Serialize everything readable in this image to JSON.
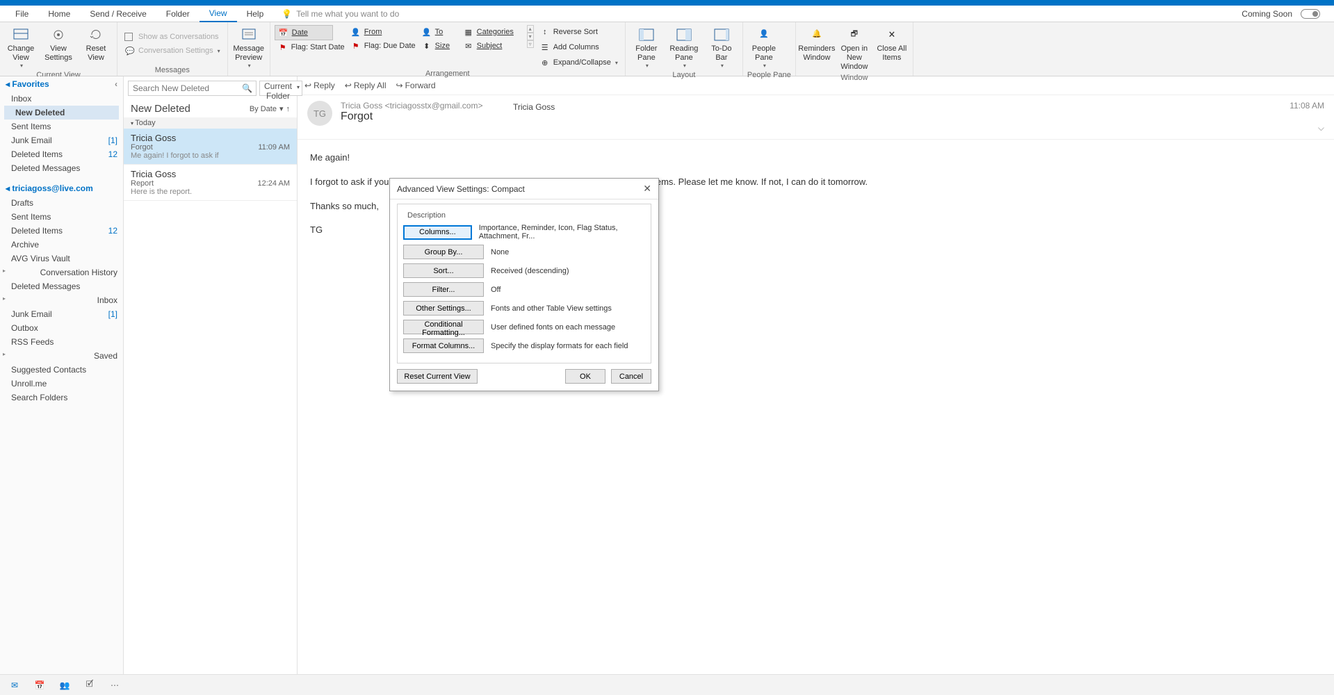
{
  "menu": {
    "tabs": [
      "File",
      "Home",
      "Send / Receive",
      "Folder",
      "View",
      "Help"
    ],
    "active": 4,
    "tellme": "Tell me what you want to do",
    "coming_soon": "Coming Soon",
    "toggle_label": "Off"
  },
  "ribbon": {
    "g1": {
      "change_view": "Change View",
      "view_settings": "View Settings",
      "reset_view": "Reset View",
      "label": "Current View"
    },
    "g2": {
      "show_conv": "Show as Conversations",
      "conv_settings": "Conversation Settings",
      "label": "Messages"
    },
    "g3": {
      "msg_preview": "Message Preview"
    },
    "g4": {
      "date": "Date",
      "from": "From",
      "to": "To",
      "flag_start": "Flag: Start Date",
      "flag_due": "Flag: Due Date",
      "size": "Size",
      "categories": "Categories",
      "subject": "Subject",
      "label": "Arrangement",
      "reverse": "Reverse Sort",
      "add_cols": "Add Columns",
      "expand": "Expand/Collapse"
    },
    "g5": {
      "folder": "Folder Pane",
      "reading": "Reading Pane",
      "todo": "To-Do Bar",
      "label": "Layout"
    },
    "g6": {
      "people": "People Pane",
      "label": "People Pane"
    },
    "g7": {
      "reminders": "Reminders Window",
      "open_new": "Open in New Window",
      "close_all": "Close All Items",
      "label": "Window"
    }
  },
  "nav": {
    "favorites": "Favorites",
    "fav_items": [
      {
        "t": "Inbox"
      },
      {
        "t": "New Deleted",
        "sel": true
      },
      {
        "t": "Sent Items"
      },
      {
        "t": "Junk Email",
        "c": "[1]"
      },
      {
        "t": "Deleted Items",
        "c": "12"
      },
      {
        "t": "Deleted Messages"
      }
    ],
    "account": "triciagoss@live.com",
    "acct_items": [
      {
        "t": "Drafts"
      },
      {
        "t": "Sent Items"
      },
      {
        "t": "Deleted Items",
        "c": "12"
      },
      {
        "t": "Archive"
      },
      {
        "t": "AVG Virus Vault"
      },
      {
        "t": "Conversation History",
        "exp": true
      },
      {
        "t": "Deleted Messages"
      },
      {
        "t": "Inbox",
        "exp": true
      },
      {
        "t": "Junk Email",
        "c": "[1]"
      },
      {
        "t": "Outbox"
      },
      {
        "t": "RSS Feeds"
      },
      {
        "t": "Saved",
        "exp": true
      },
      {
        "t": "Suggested Contacts"
      },
      {
        "t": "Unroll.me"
      },
      {
        "t": "Search Folders"
      }
    ]
  },
  "msglist": {
    "search_ph": "Search New Deleted",
    "scope": "Current Folder",
    "title": "New Deleted",
    "sort": "By Date",
    "group": "Today",
    "items": [
      {
        "from": "Tricia Goss",
        "subj": "Forgot",
        "time": "11:09 AM",
        "prev": "Me again!  I forgot to ask if",
        "sel": true
      },
      {
        "from": "Tricia Goss",
        "subj": "Report",
        "time": "12:24 AM",
        "prev": "Here is the report. <end>"
      }
    ]
  },
  "reading": {
    "reply": "Reply",
    "reply_all": "Reply All",
    "forward": "Forward",
    "avatar": "TG",
    "from_display": "Tricia Goss <triciagosstx@gmail.com>",
    "to": "Tricia Goss",
    "subject": "Forgot",
    "time": "11:08 AM",
    "body": [
      "Me again!",
      "I forgot to ask if you will have a chance to run by the printers to pick up the marketing items. Please let me know. If not, I can do it tomorrow.",
      "Thanks so much,",
      "TG"
    ]
  },
  "dialog": {
    "title": "Advanced View Settings: Compact",
    "desc": "Description",
    "rows": [
      {
        "btn": "Columns...",
        "val": "Importance, Reminder, Icon, Flag Status, Attachment, Fr...",
        "primary": true
      },
      {
        "btn": "Group By...",
        "val": "None"
      },
      {
        "btn": "Sort...",
        "val": "Received (descending)"
      },
      {
        "btn": "Filter...",
        "val": "Off"
      },
      {
        "btn": "Other Settings...",
        "val": "Fonts and other Table View settings"
      },
      {
        "btn": "Conditional Formatting...",
        "val": "User defined fonts on each message"
      },
      {
        "btn": "Format Columns...",
        "val": "Specify the display formats for each field"
      }
    ],
    "reset": "Reset Current View",
    "ok": "OK",
    "cancel": "Cancel"
  }
}
